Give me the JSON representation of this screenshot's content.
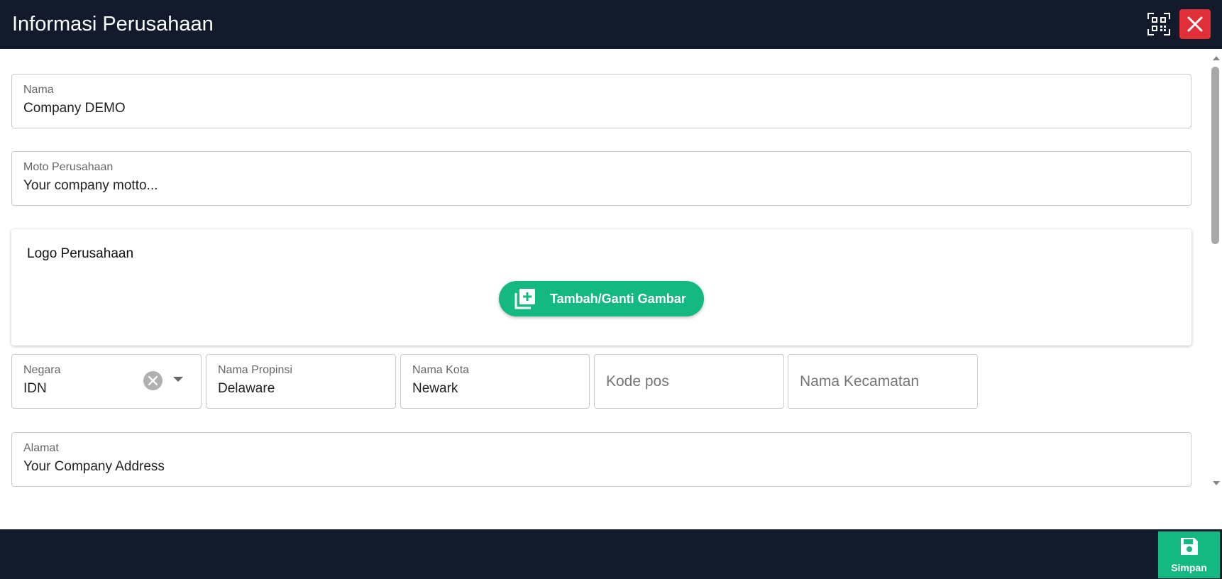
{
  "header": {
    "title": "Informasi Perusahaan",
    "qr_icon": "qr-code-icon",
    "close_icon": "close-icon"
  },
  "form": {
    "nama": {
      "label": "Nama",
      "value": "Company DEMO"
    },
    "moto": {
      "label": "Moto Perusahaan",
      "value": "Your company motto..."
    },
    "logo": {
      "title": "Logo Perusahaan",
      "button_label": "Tambah/Ganti Gambar",
      "button_icon": "add-image-icon"
    },
    "negara": {
      "label": "Negara",
      "value": "IDN"
    },
    "propinsi": {
      "label": "Nama Propinsi",
      "value": "Delaware"
    },
    "kota": {
      "label": "Nama Kota",
      "value": "Newark"
    },
    "kode_pos": {
      "placeholder": "Kode pos"
    },
    "kecamatan": {
      "placeholder": "Nama Kecamatan"
    },
    "alamat": {
      "label": "Alamat",
      "value": "Your Company Address"
    }
  },
  "footer": {
    "save_label": "Simpan",
    "save_icon": "save-icon"
  },
  "colors": {
    "header_bg": "#121a2c",
    "close_bg": "#e02f36",
    "accent_green": "#13b981"
  }
}
